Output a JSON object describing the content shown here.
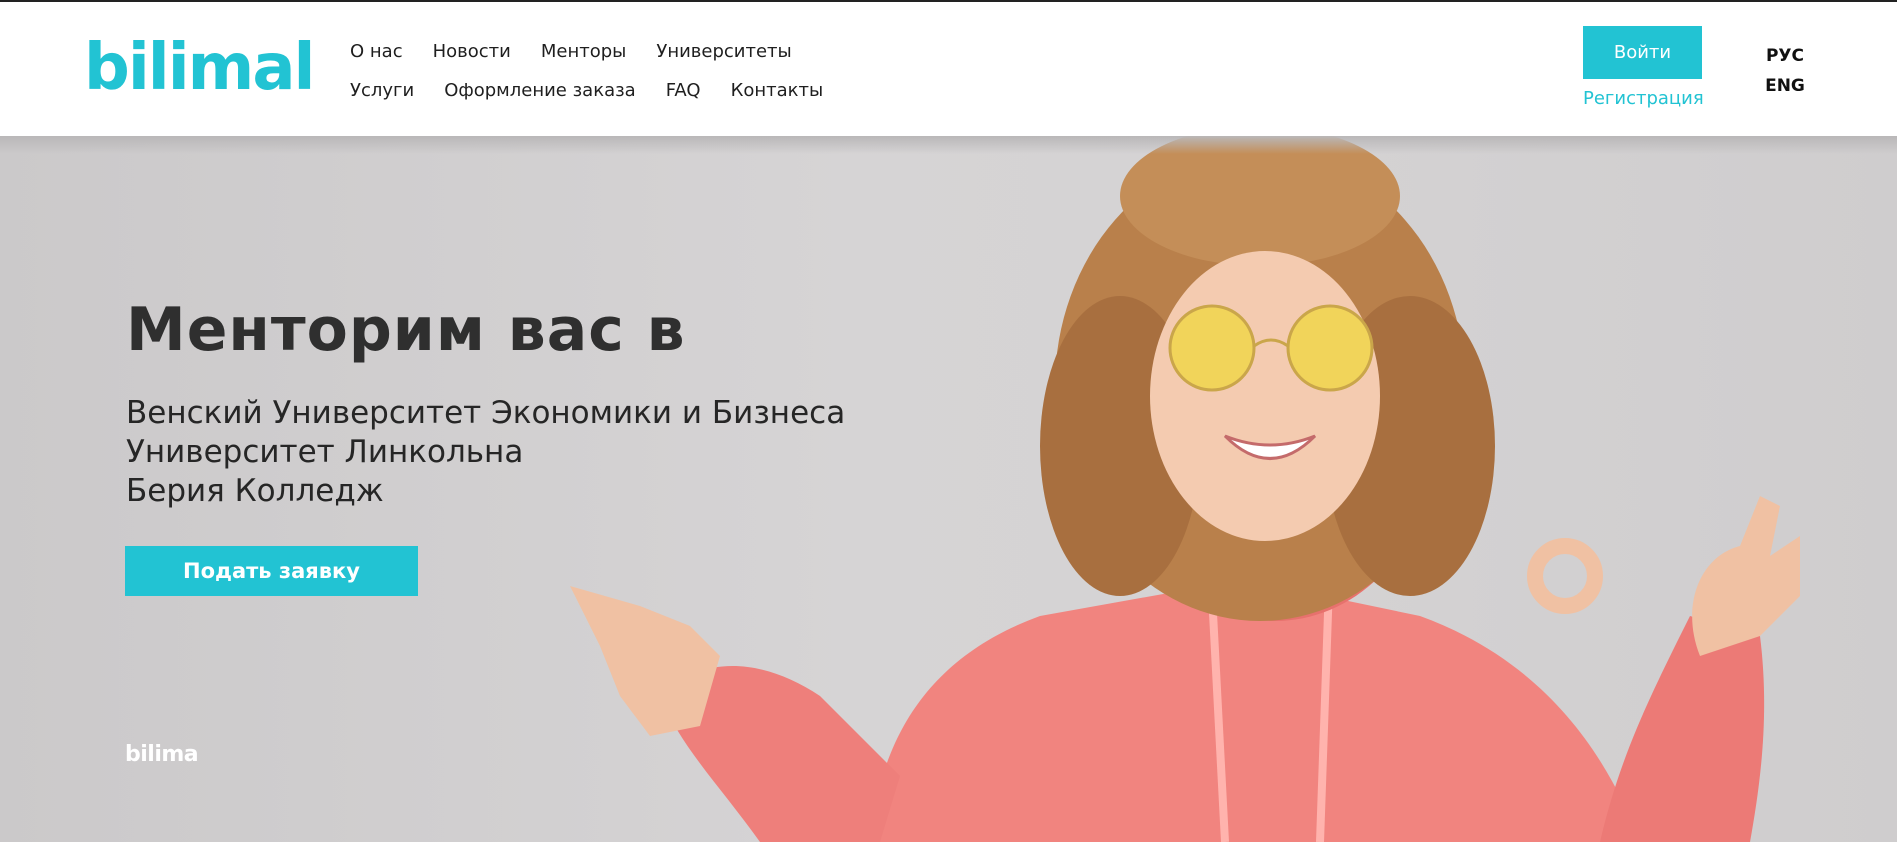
{
  "brand": {
    "logo_text": "bilimal",
    "accent_color": "#22c3d3"
  },
  "nav": {
    "row1": [
      "О нас",
      "Новости",
      "Менторы",
      "Университеты"
    ],
    "row2": [
      "Услуги",
      "Оформление заказа",
      "FAQ",
      "Контакты"
    ]
  },
  "auth": {
    "login_label": "Войти",
    "register_label": "Регистрация"
  },
  "languages": [
    "РУС",
    "ENG"
  ],
  "hero": {
    "title": "Менторим вас в",
    "universities": [
      "Венский Университет Экономики и Бизнеса",
      "Университет Линкольна",
      "Берия Колледж"
    ],
    "cta_label": "Подать заявку",
    "watermark_text": "bilima"
  }
}
